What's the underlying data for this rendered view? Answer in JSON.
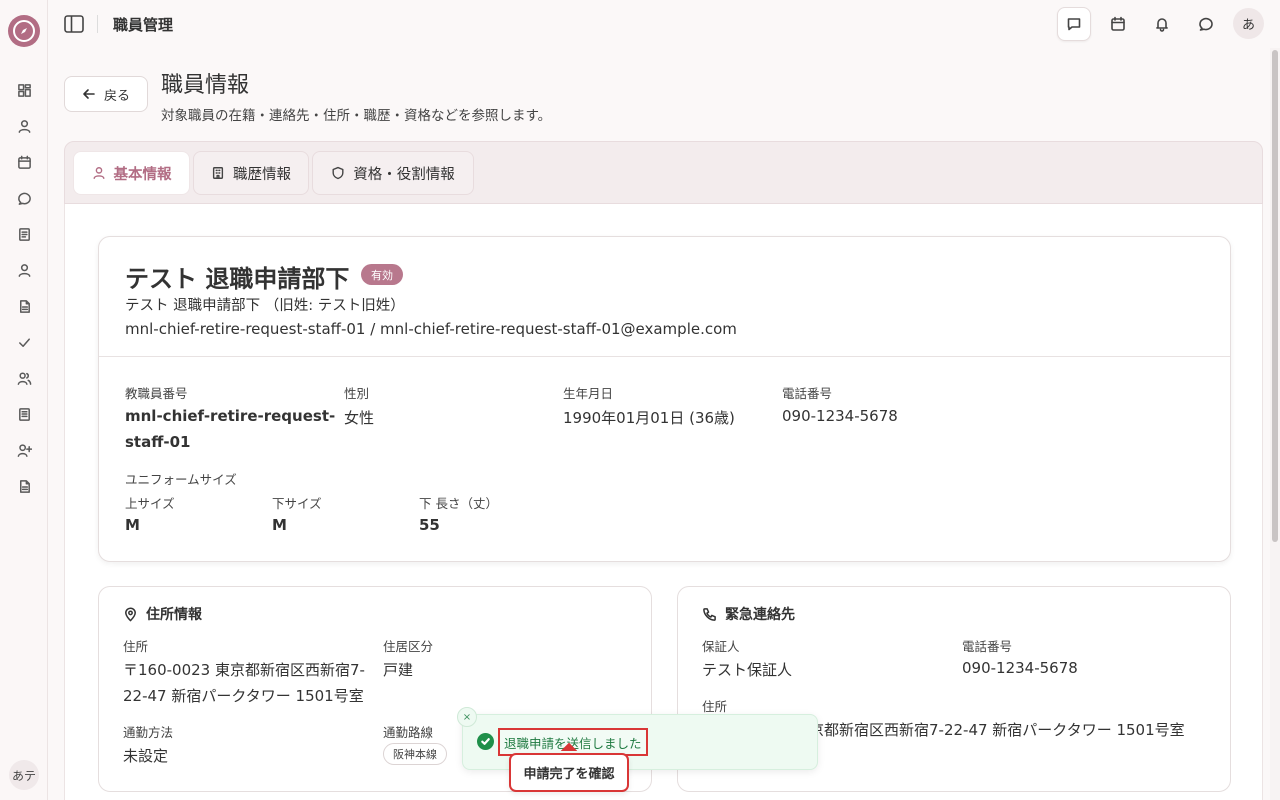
{
  "app": {
    "section_title": "職員管理",
    "user_initial_top": "あ",
    "user_initial_sidebar": "あテ"
  },
  "sidebar": {
    "items": [
      {
        "name": "dashboard-icon"
      },
      {
        "name": "user-icon"
      },
      {
        "name": "calendar-icon"
      },
      {
        "name": "chat-icon"
      },
      {
        "name": "document-icon"
      },
      {
        "name": "person-icon"
      },
      {
        "name": "file-icon"
      },
      {
        "name": "check-icon"
      },
      {
        "name": "users-icon"
      },
      {
        "name": "notebook-icon"
      },
      {
        "name": "user-plus-icon"
      },
      {
        "name": "report-icon"
      }
    ]
  },
  "header": {
    "back_label": "戻る",
    "title": "職員情報",
    "subtitle": "対象職員の在籍・連絡先・住所・職歴・資格などを参照します。"
  },
  "tabs": [
    {
      "label": "基本情報",
      "active": true
    },
    {
      "label": "職歴情報",
      "active": false
    },
    {
      "label": "資格・役割情報",
      "active": false
    }
  ],
  "employee": {
    "name": "テスト 退職申請部下",
    "status": "有効",
    "kana_line": "テスト 退職申請部下 （旧姓: テスト旧姓）",
    "login_line": "mnl-chief-retire-request-staff-01 / mnl-chief-retire-request-staff-01@example.com",
    "fields": {
      "staff_no_label": "教職員番号",
      "staff_no_line1": "mnl-chief-retire-request-",
      "staff_no_line2": "staff-01",
      "gender_label": "性別",
      "gender": "女性",
      "birth_label": "生年月日",
      "birth": "1990年01月01日 (36歳)",
      "phone_label": "電話番号",
      "phone": "090-1234-5678"
    },
    "uniform": {
      "label": "ユニフォームサイズ",
      "top_label": "上サイズ",
      "top": "M",
      "bottom_label": "下サイズ",
      "bottom": "M",
      "length_label": "下 長さ（丈）",
      "length": "55"
    }
  },
  "address_card": {
    "title": "住所情報",
    "address_label": "住所",
    "address_line1": "〒160-0023 東京都新宿区西新宿7-",
    "address_line2": "22-47 新宿パークタワー 1501号室",
    "residence_label": "住居区分",
    "residence": "戸建",
    "commute_label": "通勤方法",
    "commute": "未設定",
    "route_label": "通勤路線",
    "route_chip": "阪神本線"
  },
  "emergency_card": {
    "title": "緊急連絡先",
    "guarantor_label": "保証人",
    "guarantor": "テスト保証人",
    "phone_label": "電話番号",
    "phone": "090-1234-5678",
    "address_label": "住所",
    "address": "〒160-0023 東京都新宿区西新宿7-22-47 新宿パークタワー 1501号室"
  },
  "toast": {
    "close": "×",
    "message": "退職申請を送信しました",
    "action_label": "申請完了を確認"
  },
  "colors": {
    "accent": "#b26d84",
    "success": "#1f8f4a",
    "highlight": "#d93636"
  }
}
